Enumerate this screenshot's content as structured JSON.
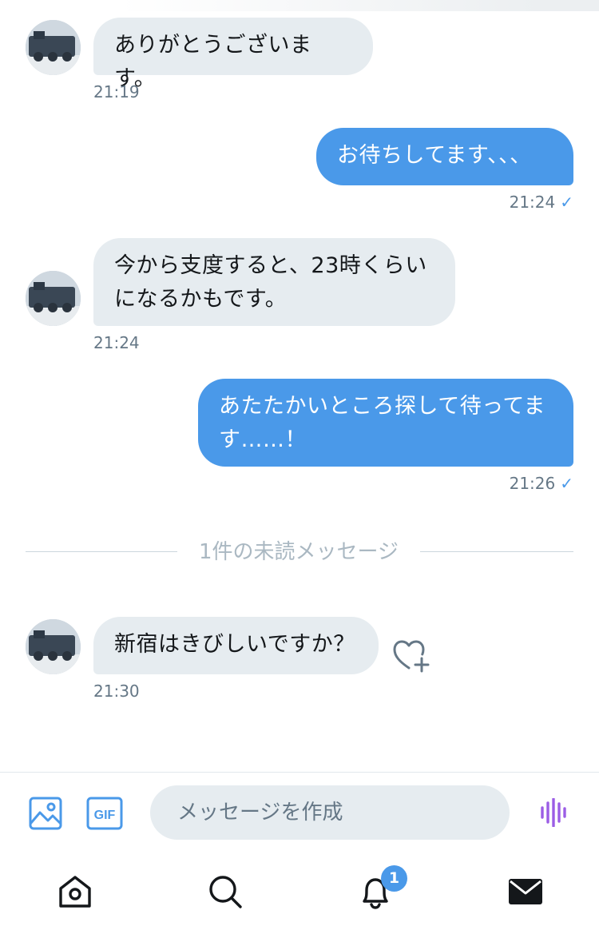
{
  "conversation": {
    "messages": [
      {
        "direction": "in",
        "text": "ありがとうございます。",
        "time": "21:19"
      },
      {
        "direction": "out",
        "text": "お待ちしてます、、、",
        "time": "21:24",
        "status": "sent"
      },
      {
        "direction": "in",
        "text_lines": [
          "今から支度すると、23時くらい",
          "になるかもです。"
        ],
        "time": "21:24"
      },
      {
        "direction": "out",
        "text_lines": [
          "あたたかいところ探して待ってま",
          "す……！"
        ],
        "time": "21:26",
        "status": "sent"
      },
      {
        "direction": "in",
        "text": "新宿はきびしいですか？",
        "time": "21:30"
      }
    ],
    "unread_divider": "1件の未読メッセージ"
  },
  "composer": {
    "placeholder": "メッセージを作成",
    "gif_label": "GIF"
  },
  "icons": {
    "media": "image-icon",
    "gif": "gif-icon",
    "voice": "voice-waveform-icon",
    "react": "heart-plus-icon",
    "read_receipt": "check-icon"
  },
  "tabbar": {
    "items": [
      "home-icon",
      "search-icon",
      "notifications-icon",
      "messages-icon"
    ],
    "notification_badge": "1"
  },
  "colors": {
    "accent": "#4a99e9",
    "incoming_bubble": "#e6ecf0",
    "voice": "#9b5de5"
  }
}
